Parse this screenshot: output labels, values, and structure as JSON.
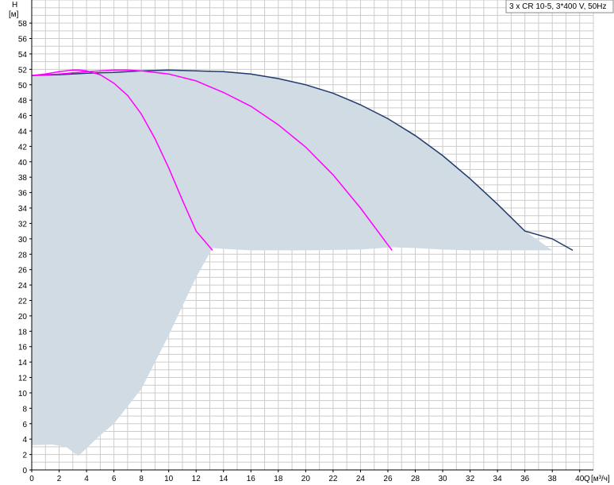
{
  "chart_data": {
    "type": "line",
    "title": "",
    "legend_label": "3 x CR 10-5, 3*400 V, 50Hz",
    "legend_position": "top-right",
    "grid": true,
    "xlabel": "Q",
    "xunit": "[м³/ч]",
    "ylabel": "H",
    "yunit": "[м]",
    "xlim": [
      0,
      41
    ],
    "ylim": [
      0,
      61
    ],
    "xticks": [
      "0",
      "2",
      "4",
      "6",
      "8",
      "10",
      "12",
      "14",
      "16",
      "18",
      "20",
      "22",
      "24",
      "26",
      "28",
      "30",
      "32",
      "34",
      "36",
      "38",
      "40"
    ],
    "yticks": [
      "0",
      "2",
      "4",
      "6",
      "8",
      "10",
      "12",
      "14",
      "16",
      "18",
      "20",
      "22",
      "24",
      "26",
      "28",
      "30",
      "32",
      "34",
      "36",
      "38",
      "40",
      "42",
      "44",
      "46",
      "48",
      "50",
      "52",
      "54",
      "56",
      "58"
    ],
    "colors": {
      "envelope_fill": "#d0dbe4",
      "max_curve": "#1f3a6b",
      "pump_curves": "#ff00ff",
      "grid": "#cccccc"
    },
    "operating_envelope": [
      [
        0,
        51.2
      ],
      [
        2,
        51.2
      ],
      [
        4,
        51.5
      ],
      [
        6,
        51.6
      ],
      [
        8,
        51.8
      ],
      [
        10,
        51.9
      ],
      [
        12,
        51.8
      ],
      [
        14,
        51.7
      ],
      [
        16,
        51.4
      ],
      [
        18,
        50.8
      ],
      [
        20,
        50.0
      ],
      [
        22,
        48.9
      ],
      [
        24,
        47.4
      ],
      [
        26,
        45.6
      ],
      [
        28,
        43.4
      ],
      [
        30,
        40.8
      ],
      [
        32,
        37.8
      ],
      [
        34,
        34.5
      ],
      [
        36,
        31.0
      ],
      [
        38,
        28.5
      ],
      [
        39.5,
        28.6
      ],
      [
        38,
        28.5
      ],
      [
        32,
        28.5
      ],
      [
        30,
        28.6
      ],
      [
        28,
        28.8
      ],
      [
        26.3,
        28.9
      ],
      [
        24,
        28.6
      ],
      [
        20,
        28.5
      ],
      [
        16,
        28.5
      ],
      [
        14,
        28.7
      ],
      [
        13.2,
        28.8
      ],
      [
        12,
        25.0
      ],
      [
        10,
        17.5
      ],
      [
        8,
        10.5
      ],
      [
        6,
        6.0
      ],
      [
        5,
        4.5
      ],
      [
        3.4,
        1.8
      ],
      [
        2.5,
        3.0
      ],
      [
        1.5,
        3.3
      ],
      [
        0,
        3.2
      ]
    ],
    "series": [
      {
        "name": "",
        "color": "#1f3a6b",
        "x": [
          0,
          2,
          4,
          6,
          8,
          10,
          12,
          14,
          16,
          18,
          20,
          22,
          24,
          26,
          28,
          30,
          32,
          34,
          36,
          38,
          39.5
        ],
        "values": [
          51.2,
          51.3,
          51.5,
          51.6,
          51.8,
          51.9,
          51.8,
          51.7,
          51.4,
          50.8,
          50.0,
          48.9,
          47.4,
          45.6,
          43.4,
          40.8,
          37.8,
          34.5,
          31.0,
          30.0,
          28.5
        ]
      },
      {
        "name": "",
        "color": "#ff00ff",
        "x": [
          0,
          1,
          2,
          3,
          3.5,
          4,
          5,
          6,
          7,
          8,
          9,
          10,
          11,
          12,
          13.2
        ],
        "values": [
          51.2,
          51.4,
          51.7,
          51.9,
          51.9,
          51.8,
          51.3,
          50.2,
          48.6,
          46.2,
          43.0,
          39.2,
          35.0,
          31.0,
          28.5
        ]
      },
      {
        "name": "",
        "color": "#ff00ff",
        "x": [
          0,
          2,
          4,
          6,
          7,
          8,
          10,
          12,
          14,
          16,
          18,
          20,
          22,
          24,
          26.3
        ],
        "values": [
          51.2,
          51.4,
          51.7,
          51.9,
          51.9,
          51.8,
          51.4,
          50.5,
          49.0,
          47.2,
          44.8,
          41.9,
          38.3,
          34.0,
          28.5
        ]
      }
    ]
  }
}
